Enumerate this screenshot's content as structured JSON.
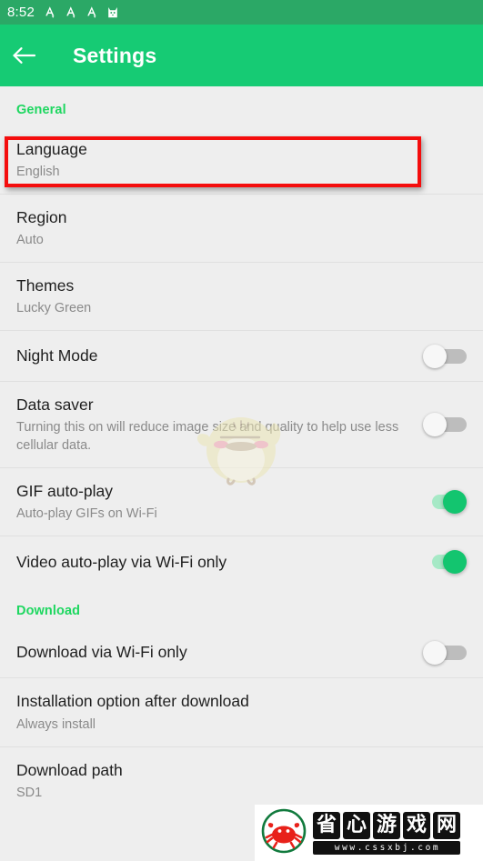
{
  "statusbar": {
    "time": "8:52",
    "icons": [
      "alarm-a-icon",
      "alarm-a-icon",
      "alarm-a-icon",
      "robot-cat-icon"
    ]
  },
  "appbar": {
    "back_label": "back-arrow",
    "title": "Settings",
    "background": "#16cb74"
  },
  "sections": [
    {
      "header": "General",
      "rows": [
        {
          "title": "Language",
          "subtitle": "English",
          "type": "value",
          "highlighted": true
        },
        {
          "title": "Region",
          "subtitle": "Auto",
          "type": "value"
        },
        {
          "title": "Themes",
          "subtitle": "Lucky Green",
          "type": "value"
        },
        {
          "title": "Night Mode",
          "subtitle": "",
          "type": "toggle",
          "toggle_state": "off"
        },
        {
          "title": "Data saver",
          "subtitle": "Turning this on will reduce image size and quality to help use less cellular data.",
          "type": "toggle",
          "toggle_state": "off"
        },
        {
          "title": "GIF auto-play",
          "subtitle": "Auto-play GIFs on Wi-Fi",
          "type": "toggle",
          "toggle_state": "on"
        },
        {
          "title": "Video auto-play via Wi-Fi only",
          "subtitle": "",
          "type": "toggle",
          "toggle_state": "on"
        }
      ]
    },
    {
      "header": "Download",
      "rows": [
        {
          "title": "Download via Wi-Fi only",
          "subtitle": "",
          "type": "toggle",
          "toggle_state": "off"
        },
        {
          "title": "Installation option after download",
          "subtitle": "Always install",
          "type": "value"
        },
        {
          "title": "Download path",
          "subtitle": "SD1",
          "type": "value"
        }
      ]
    }
  ],
  "watermark": {
    "chick": "chick-mascot-watermark",
    "logo_chars": [
      "省",
      "心",
      "游",
      "戏",
      "网"
    ],
    "logo_url": "www.cssxbj.com",
    "crab": "crab-logo-icon"
  },
  "colors": {
    "accent_green": "#1ed760",
    "appbar_green": "#16cb74",
    "statusbar_green": "#2ba866",
    "toggle_on": "#13c56f",
    "highlight_red": "#f40d0d",
    "list_bg": "#eeeeee"
  }
}
